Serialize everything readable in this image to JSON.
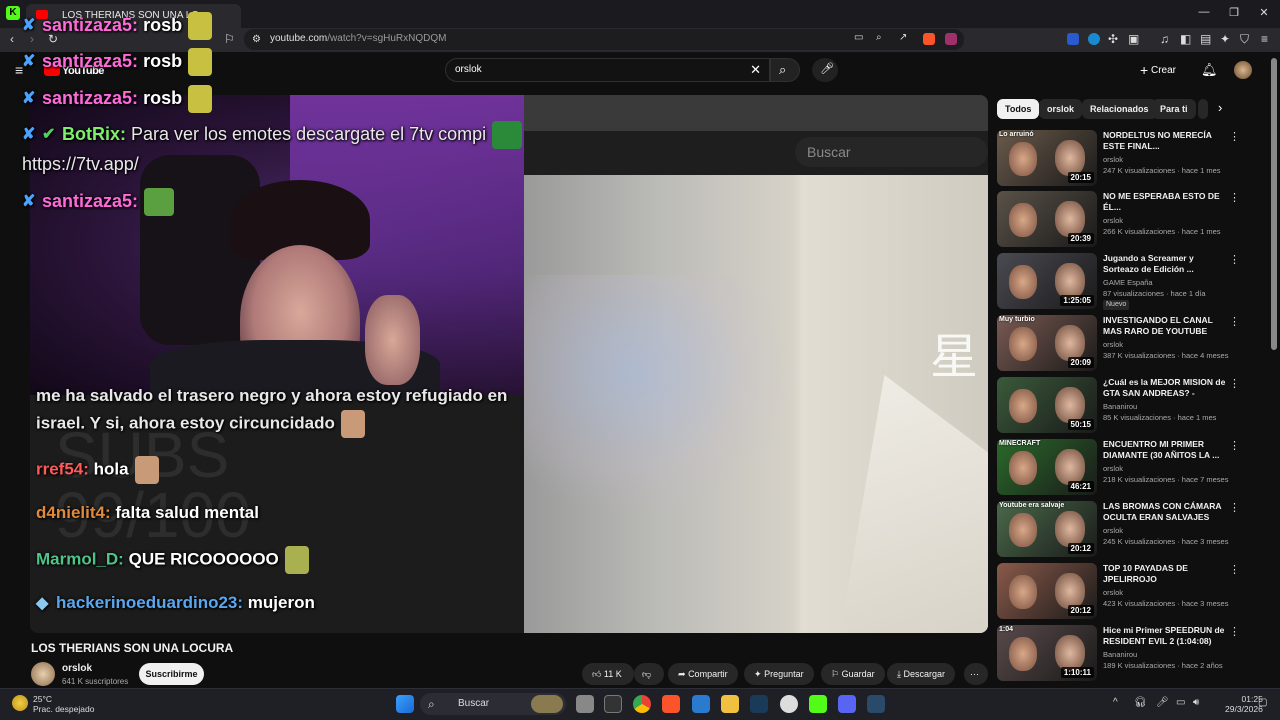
{
  "browser": {
    "tab_title": "LOS THERIANS SON UNA LO",
    "url_host": "youtube.com",
    "url_path": "/watch?v=sgHuRxNQDQM"
  },
  "youtube": {
    "logo_text": "YouTube",
    "search_value": "orslok",
    "create_label": "Crear"
  },
  "video": {
    "in_video_search_placeholder": "Buscar",
    "kanji": "星",
    "subs_overlay": "SUBS\n99/100",
    "chat_messages": [
      {
        "user": "santizaza5:",
        "msg": "rosb",
        "user_color": "#ff69d9"
      },
      {
        "user": "santizaza5:",
        "msg": "rosb",
        "user_color": "#ff69d9"
      },
      {
        "user": "santizaza5:",
        "msg": "rosb",
        "user_color": "#ff69d9"
      },
      {
        "user": "BotRix:",
        "msg": "Para ver los emotes descargate el 7tv compi",
        "user_color": "#7cf06a"
      },
      {
        "user": "",
        "msg": "https://7tv.app/",
        "user_color": "#ffffff"
      },
      {
        "user": "santizaza5:",
        "msg": "",
        "user_color": "#ff69d9"
      }
    ],
    "chat_lower": [
      {
        "user": "",
        "msg": "me ha salvado el trasero negro y ahora estoy refugiado en",
        "user_color": "#ffffff"
      },
      {
        "user": "",
        "msg": "israel. Y si, ahora estoy circuncidado",
        "user_color": "#ffffff"
      },
      {
        "user": "rref54:",
        "msg": "hola",
        "user_color": "#ff5a5a"
      },
      {
        "user": "d4nielit4:",
        "msg": "falta salud mental",
        "user_color": "#e08a3a"
      },
      {
        "user": "Marmol_D:",
        "msg": "QUE RICOOOOOO",
        "user_color": "#4fc48a"
      },
      {
        "user": "hackerinoeduardino23:",
        "msg": "mujeron",
        "user_color": "#5aa7f0"
      }
    ]
  },
  "below": {
    "title": "LOS THERIANS SON UNA LOCURA",
    "channel": "orslok",
    "subscribers": "641 K suscriptores",
    "subscribe_label": "Suscribirme",
    "likes": "11 K",
    "share_label": "Compartir",
    "ask_label": "Preguntar",
    "save_label": "Guardar",
    "download_label": "Descargar"
  },
  "chips": [
    "Todos",
    "orslok",
    "Relacionados",
    "Para ti"
  ],
  "recommendations": [
    {
      "title": "NORDELTUS NO MERECÍA ESTE FINAL...",
      "channel": "orslok",
      "meta": "247 K visualizaciones · hace 1 mes",
      "duration": "20:15",
      "thumb_color": "#6a5a4a",
      "overlay": "Lo arruinó"
    },
    {
      "title": "NO ME ESPERABA ESTO DE ÉL...",
      "channel": "orslok",
      "meta": "266 K visualizaciones · hace 1 mes",
      "duration": "20:39",
      "thumb_color": "#5a5248",
      "overlay": ""
    },
    {
      "title": "Jugando a Screamer y Sorteazo de Edición ...",
      "channel": "GAME España",
      "meta": "87 visualizaciones · hace 1 día",
      "duration": "1:25:05",
      "thumb_color": "#4a4a52",
      "overlay": "",
      "badge": "Nuevo"
    },
    {
      "title": "INVESTIGANDO EL CANAL MAS RARO DE YOUTUBE",
      "channel": "orslok",
      "meta": "387 K visualizaciones · hace 4 meses",
      "duration": "20:09",
      "thumb_color": "#7a5a52",
      "overlay": "Muy turbio"
    },
    {
      "title": "¿Cuál es la MEJOR MISION de GTA SAN ANDREAS? - TIERLIS...",
      "channel": "Bananirou",
      "meta": "85 K visualizaciones · hace 1 mes",
      "duration": "50:15",
      "thumb_color": "#3a5a3a",
      "overlay": ""
    },
    {
      "title": "ENCUENTRO MI PRIMER DIAMANTE (30 AÑITOS LA ...",
      "channel": "orslok",
      "meta": "218 K visualizaciones · hace 7 meses",
      "duration": "46:21",
      "thumb_color": "#2a6a2a",
      "overlay": "MINECRAFT"
    },
    {
      "title": "LAS BROMAS CON CÁMARA OCULTA ERAN SALVAJES",
      "channel": "orslok",
      "meta": "245 K visualizaciones · hace 3 meses",
      "duration": "20:12",
      "thumb_color": "#4a6a4a",
      "overlay": "Youtube era salvaje"
    },
    {
      "title": "TOP 10 PAYADAS DE JPELIRROJO",
      "channel": "orslok",
      "meta": "423 K visualizaciones · hace 3 meses",
      "duration": "20:12",
      "thumb_color": "#8a5a4a",
      "overlay": ""
    },
    {
      "title": "Hice mi Primer SPEEDRUN de RESIDENT EVIL 2 (1:04:08)",
      "channel": "Bananirou",
      "meta": "189 K visualizaciones · hace 2 años",
      "duration": "1:10:11",
      "thumb_color": "#5a4a4a",
      "overlay": "1:04"
    }
  ],
  "taskbar": {
    "temp": "25°C",
    "weather": "Prac. despejado",
    "search_label": "Buscar",
    "time": "01:25",
    "date": "29/3/2026"
  }
}
